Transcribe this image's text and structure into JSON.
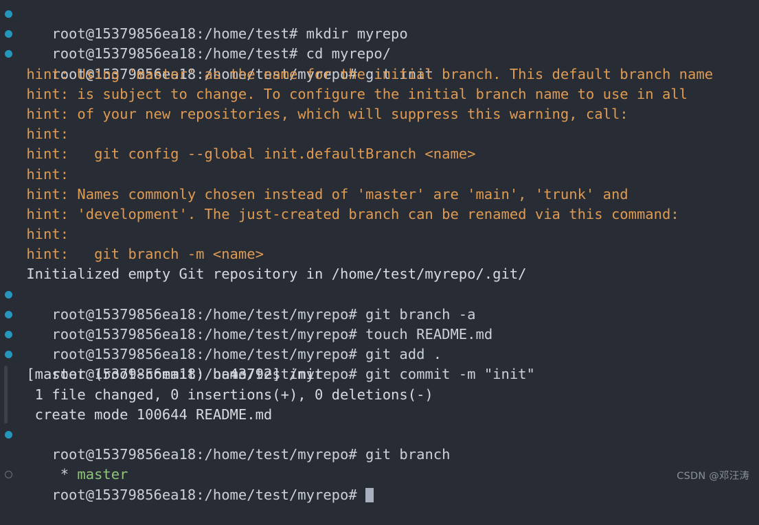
{
  "terminal": {
    "background_color": "#282c34",
    "prompt_color": "#ccd1d9",
    "output_color": "#d7dae0",
    "hint_color": "#e09b52",
    "branch_color": "#8fc57b",
    "marker_color": "#2596be",
    "idle_marker_color": "#6b7280",
    "cursor_color": "#a8b0c0",
    "host_prompt_home": "root@15379856ea18:/home/test#",
    "host_prompt_repo": "root@15379856ea18:/home/test/myrepo#",
    "lines": [
      {
        "type": "prompt",
        "marker": "filled-dot",
        "prompt": "root@15379856ea18:/home/test#",
        "command": " mkdir myrepo"
      },
      {
        "type": "prompt",
        "marker": "filled-dot",
        "prompt": "root@15379856ea18:/home/test#",
        "command": " cd myrepo/"
      },
      {
        "type": "prompt",
        "marker": "filled-dot",
        "prompt": "root@15379856ea18:/home/test/myrepo#",
        "command": " git init"
      },
      {
        "type": "output",
        "style": "hint",
        "text": " hint: Using 'master' as the name for the initial branch. This default branch name"
      },
      {
        "type": "output",
        "style": "hint",
        "text": " hint: is subject to change. To configure the initial branch name to use in all"
      },
      {
        "type": "output",
        "style": "hint",
        "text": " hint: of your new repositories, which will suppress this warning, call:"
      },
      {
        "type": "output",
        "style": "hint",
        "text": " hint:"
      },
      {
        "type": "output",
        "style": "hint",
        "text": " hint:   git config --global init.defaultBranch <name>"
      },
      {
        "type": "output",
        "style": "hint",
        "text": " hint:"
      },
      {
        "type": "output",
        "style": "hint",
        "text": " hint: Names commonly chosen instead of 'master' are 'main', 'trunk' and"
      },
      {
        "type": "output",
        "style": "hint",
        "text": " hint: 'development'. The just-created branch can be renamed via this command:"
      },
      {
        "type": "output",
        "style": "hint",
        "text": " hint:"
      },
      {
        "type": "output",
        "style": "hint",
        "text": " hint:   git branch -m <name>"
      },
      {
        "type": "output",
        "style": "normal",
        "text": " Initialized empty Git repository in /home/test/myrepo/.git/"
      },
      {
        "type": "prompt",
        "marker": "filled-dot",
        "prompt": "root@15379856ea18:/home/test/myrepo#",
        "command": " git branch -a"
      },
      {
        "type": "prompt",
        "marker": "filled-dot",
        "prompt": "root@15379856ea18:/home/test/myrepo#",
        "command": " touch README.md"
      },
      {
        "type": "prompt",
        "marker": "filled-dot",
        "prompt": "root@15379856ea18:/home/test/myrepo#",
        "command": " git add ."
      },
      {
        "type": "prompt",
        "marker": "filled-dot",
        "prompt": "root@15379856ea18:/home/test/myrepo#",
        "command": " git commit -m \"init\""
      },
      {
        "type": "output",
        "style": "normal",
        "railed": true,
        "text": " [master (root-commit) ba43792] init"
      },
      {
        "type": "output",
        "style": "normal",
        "railed": true,
        "text": "  1 file changed, 0 insertions(+), 0 deletions(-)"
      },
      {
        "type": "output",
        "style": "normal",
        "railed": true,
        "text": "  create mode 100644 README.md"
      },
      {
        "type": "prompt",
        "marker": "filled-dot",
        "prompt": "root@15379856ea18:/home/test/myrepo#",
        "command": " git branch"
      },
      {
        "type": "output",
        "style": "branch",
        "star": " * ",
        "branch": "master"
      },
      {
        "type": "prompt",
        "marker": "hollow-dot",
        "prompt": "root@15379856ea18:/home/test/myrepo#",
        "command": " ",
        "cursor": true
      }
    ]
  },
  "watermark": {
    "text": "CSDN @邓汪涛"
  }
}
